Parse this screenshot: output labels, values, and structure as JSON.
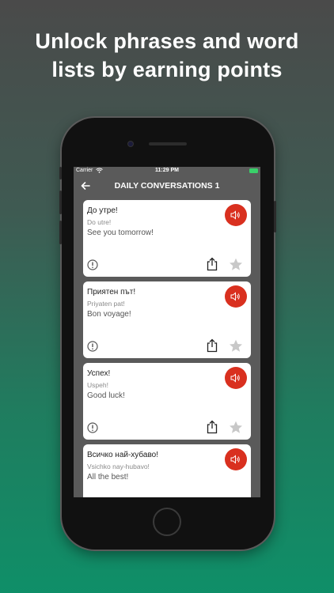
{
  "headline": "Unlock phrases and word lists by earning points",
  "status": {
    "carrier": "Carrier",
    "time": "11:29 PM"
  },
  "nav": {
    "title": "DAILY CONVERSATIONS 1"
  },
  "phrases": [
    {
      "native": "До утре!",
      "transliteration": "Do utre!",
      "english": "See you tomorrow!"
    },
    {
      "native": "Приятен път!",
      "transliteration": "Priyaten pat!",
      "english": "Bon voyage!"
    },
    {
      "native": "Успех!",
      "transliteration": "Uspeh!",
      "english": "Good luck!"
    },
    {
      "native": "Всичко най-хубаво!",
      "transliteration": "Vsichko nay-hubavo!",
      "english": "All the best!"
    }
  ],
  "icons": {
    "back": "back-arrow-icon",
    "speak": "speaker-icon",
    "report": "report-icon",
    "share": "share-icon",
    "favorite": "star-icon"
  },
  "colors": {
    "speak_button": "#d9301f",
    "header_bg": "#5a5a5a",
    "background_bottom": "#0f8f68"
  }
}
